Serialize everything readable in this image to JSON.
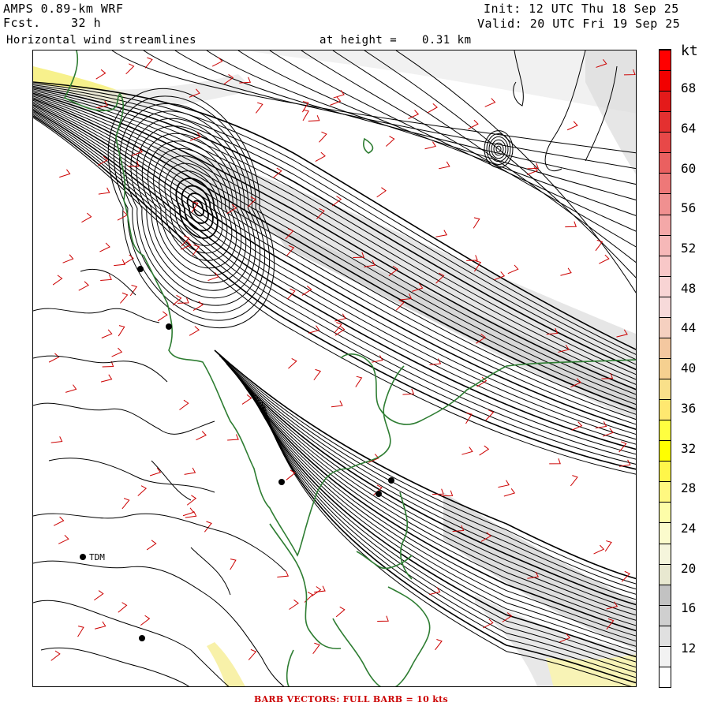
{
  "header": {
    "model": "AMPS 0.89-km WRF",
    "forecast_label": "Fcst.",
    "forecast_value": "32 h",
    "product": "Horizontal wind streamlines",
    "height_label": "at height =",
    "height_value": "0.31 km",
    "init": "Init: 12 UTC Thu 18 Sep 25",
    "valid": "Valid: 20 UTC Fri 19 Sep 25"
  },
  "colorbar": {
    "units": "kt",
    "tick_labels": [
      "12",
      "16",
      "20",
      "24",
      "28",
      "32",
      "36",
      "40",
      "44",
      "48",
      "52",
      "56",
      "60",
      "64",
      "68"
    ],
    "colors": [
      "#ffffff",
      "#f2f2f2",
      "#e0e0e0",
      "#cfcfcf",
      "#c2c2c2",
      "#e8e8d0",
      "#f5f5dc",
      "#fbfbcc",
      "#fdfda8",
      "#fff880",
      "#fff64a",
      "#ffff00",
      "#ffff40",
      "#ffe870",
      "#f9e08a",
      "#f5d090",
      "#f4c8a0",
      "#f5d0c0",
      "#f7dada",
      "#f8d4d4",
      "#f8c8c8",
      "#f6b8b8",
      "#f4a8a8",
      "#f09090",
      "#ee7878",
      "#ea6060",
      "#e84848",
      "#e43030",
      "#e41a1a",
      "#f20000",
      "#ff0000"
    ]
  },
  "stations": [
    {
      "name": "",
      "id": "s1"
    },
    {
      "name": "",
      "id": "s2"
    },
    {
      "name": "",
      "id": "s3"
    },
    {
      "name": "",
      "id": "s4"
    },
    {
      "name": "",
      "id": "s5"
    },
    {
      "name": "TDM",
      "id": "s6"
    },
    {
      "name": "",
      "id": "s7"
    }
  ],
  "footer": "BARB VECTORS:  FULL BARB = 10 kts",
  "colors": {
    "streamline": "#000000",
    "coastline": "#2e7d32",
    "barb": "#cc0000",
    "shading_light": "#e6e6e6",
    "shading_yellow": "#fbf6b0"
  }
}
